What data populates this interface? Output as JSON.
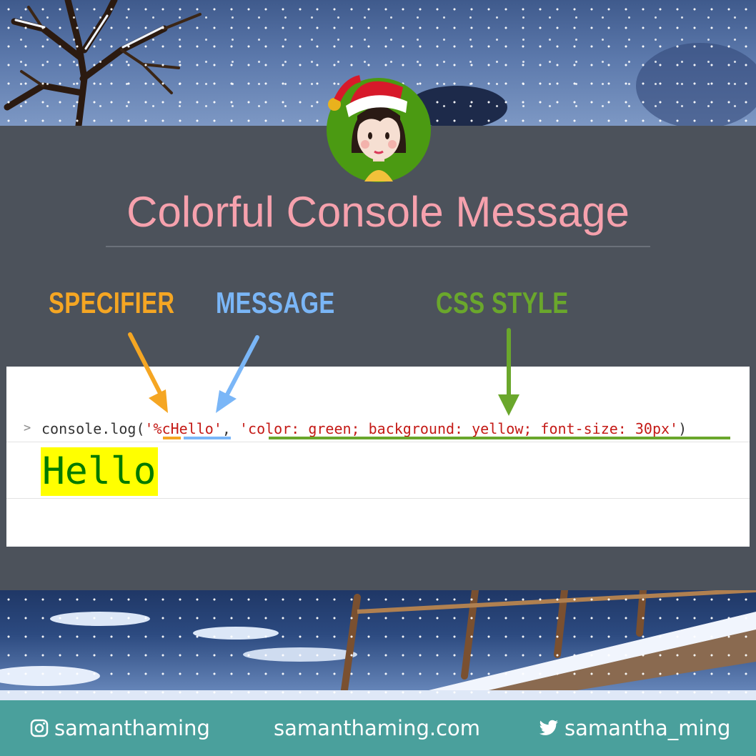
{
  "title": "Colorful Console Message",
  "labels": {
    "specifier": "SPECIFIER",
    "message": "MESSAGE",
    "css_style": "CSS STYLE"
  },
  "console": {
    "prompt": ">",
    "code_prefix": "console.log(",
    "quote_open": "'",
    "specifier": "%c",
    "message": "Hello",
    "quote_close": "'",
    "separator": ", ",
    "style_string": "'color: green; background: yellow; font-size: 30px'",
    "code_suffix": ")",
    "output_text": "Hello"
  },
  "footer": {
    "instagram": "samanthaming",
    "website": "samanthaming.com",
    "twitter": "samantha_ming"
  },
  "colors": {
    "title": "#f6a1ad",
    "specifier": "#f5a623",
    "message": "#7ab6f7",
    "css_style": "#6aa72c",
    "panel": "#4c525b",
    "footer": "#4aa09c",
    "output_text": "#007a00",
    "output_bg": "#ffff00"
  },
  "icons": {
    "instagram": "instagram-icon",
    "twitter": "twitter-icon"
  }
}
